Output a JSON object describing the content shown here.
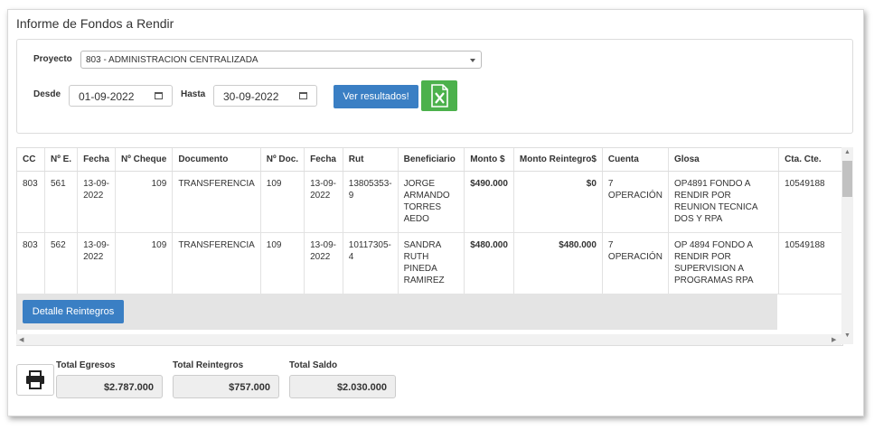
{
  "page": {
    "title": "Informe de Fondos a Rendir"
  },
  "filters": {
    "proyecto_label": "Proyecto",
    "proyecto_value": "803 - ADMINISTRACION CENTRALIZADA",
    "desde_label": "Desde",
    "desde_value": "01-09-2022",
    "hasta_label": "Hasta",
    "hasta_value": "30-09-2022",
    "ver_label": "Ver resultados!",
    "excel_icon": "excel-file-icon"
  },
  "table": {
    "headers": [
      "CC",
      "Nº E.",
      "Fecha",
      "Nº Cheque",
      "Documento",
      "Nº Doc.",
      "Fecha",
      "Rut",
      "Beneficiario",
      "Monto $",
      "Monto Reintegro$",
      "Cuenta",
      "Glosa",
      "Cta. Cte."
    ],
    "rows": [
      {
        "cc": "803",
        "ne": "561",
        "fecha": "13-09-2022",
        "cheque": "109",
        "documento": "TRANSFERENCIA",
        "ndoc": "109",
        "fecha2": "13-09-2022",
        "rut": "13805353-9",
        "beneficiario": "JORGE ARMANDO TORRES AEDO",
        "monto": "$490.000",
        "reintegro": "$0",
        "cuenta": "7 OPERACIÓN",
        "glosa": "OP4891 FONDO A RENDIR POR REUNION TECNICA DOS Y RPA",
        "ctacte": "10549188"
      },
      {
        "cc": "803",
        "ne": "562",
        "fecha": "13-09-2022",
        "cheque": "109",
        "documento": "TRANSFERENCIA",
        "ndoc": "109",
        "fecha2": "13-09-2022",
        "rut": "10117305-4",
        "beneficiario": "SANDRA RUTH PINEDA RAMIREZ",
        "monto": "$480.000",
        "reintegro": "$480.000",
        "cuenta": "7 OPERACIÓN",
        "glosa": "OP 4894 FONDO A RENDIR POR SUPERVISION A PROGRAMAS RPA",
        "ctacte": "10549188"
      }
    ],
    "detalle_label": "Detalle Reintegros"
  },
  "totals": {
    "egresos_label": "Total Egresos",
    "egresos_value": "$2.787.000",
    "reintegros_label": "Total Reintegros",
    "reintegros_value": "$757.000",
    "saldo_label": "Total Saldo",
    "saldo_value": "$2.030.000"
  },
  "colors": {
    "primary": "#3a7fc4",
    "excel": "#4cb14c"
  }
}
